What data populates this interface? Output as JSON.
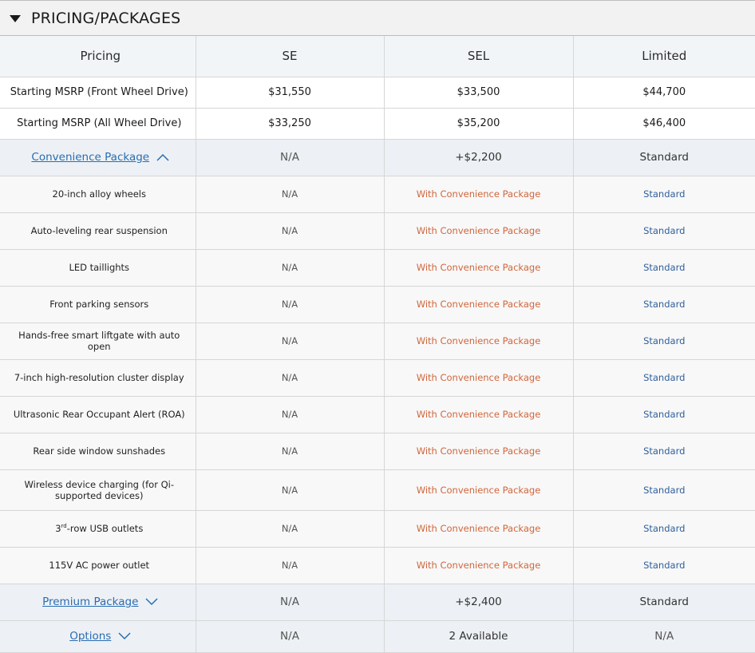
{
  "section": {
    "title": "PRICING/PACKAGES",
    "toggle_icon": "caret-down-icon"
  },
  "table": {
    "header": [
      "Pricing",
      "SE",
      "SEL",
      "Limited"
    ],
    "price_rows": [
      {
        "label": "Starting MSRP (Front Wheel Drive)",
        "values": [
          "$31,550",
          "$33,500",
          "$44,700"
        ]
      },
      {
        "label": "Starting MSRP (All Wheel Drive)",
        "values": [
          "$33,250",
          "$35,200",
          "$46,400"
        ]
      }
    ],
    "convenience": {
      "label": "Convenience Package",
      "icon": "chevron-up-icon",
      "values": [
        "N/A",
        "+$2,200",
        "Standard"
      ],
      "features": [
        {
          "label": "20-inch alloy wheels",
          "values": [
            "N/A",
            "With Convenience Package",
            "Standard"
          ]
        },
        {
          "label": "Auto-leveling rear suspension",
          "values": [
            "N/A",
            "With Convenience Package",
            "Standard"
          ]
        },
        {
          "label": "LED taillights",
          "values": [
            "N/A",
            "With Convenience Package",
            "Standard"
          ]
        },
        {
          "label": "Front parking sensors",
          "values": [
            "N/A",
            "With Convenience Package",
            "Standard"
          ]
        },
        {
          "label": "Hands-free smart liftgate with auto open",
          "values": [
            "N/A",
            "With Convenience Package",
            "Standard"
          ]
        },
        {
          "label": "7-inch high-resolution cluster display",
          "values": [
            "N/A",
            "With Convenience Package",
            "Standard"
          ]
        },
        {
          "label": "Ultrasonic Rear Occupant Alert (ROA)",
          "values": [
            "N/A",
            "With Convenience Package",
            "Standard"
          ]
        },
        {
          "label": "Rear side window sunshades",
          "values": [
            "N/A",
            "With Convenience Package",
            "Standard"
          ]
        },
        {
          "label": "Wireless device charging (for Qi-supported devices)",
          "values": [
            "N/A",
            "With Convenience Package",
            "Standard"
          ]
        },
        {
          "label_prefix": "3",
          "label_sup": "rd",
          "label_suffix": "-row USB outlets",
          "values": [
            "N/A",
            "With Convenience Package",
            "Standard"
          ]
        },
        {
          "label": "115V AC power outlet",
          "values": [
            "N/A",
            "With Convenience Package",
            "Standard"
          ]
        }
      ]
    },
    "premium": {
      "label": "Premium Package",
      "icon": "chevron-down-icon",
      "values": [
        "N/A",
        "+$2,400",
        "Standard"
      ]
    },
    "options": {
      "label": "Options",
      "icon": "chevron-down-icon",
      "values": [
        "N/A",
        "2 Available",
        "N/A"
      ]
    }
  },
  "colors": {
    "link": "#2a6db0",
    "with_package": "#d0663c",
    "standard": "#2e5f9b",
    "header_bg": "#f2f5f8",
    "package_row_bg": "#edf1f5"
  }
}
